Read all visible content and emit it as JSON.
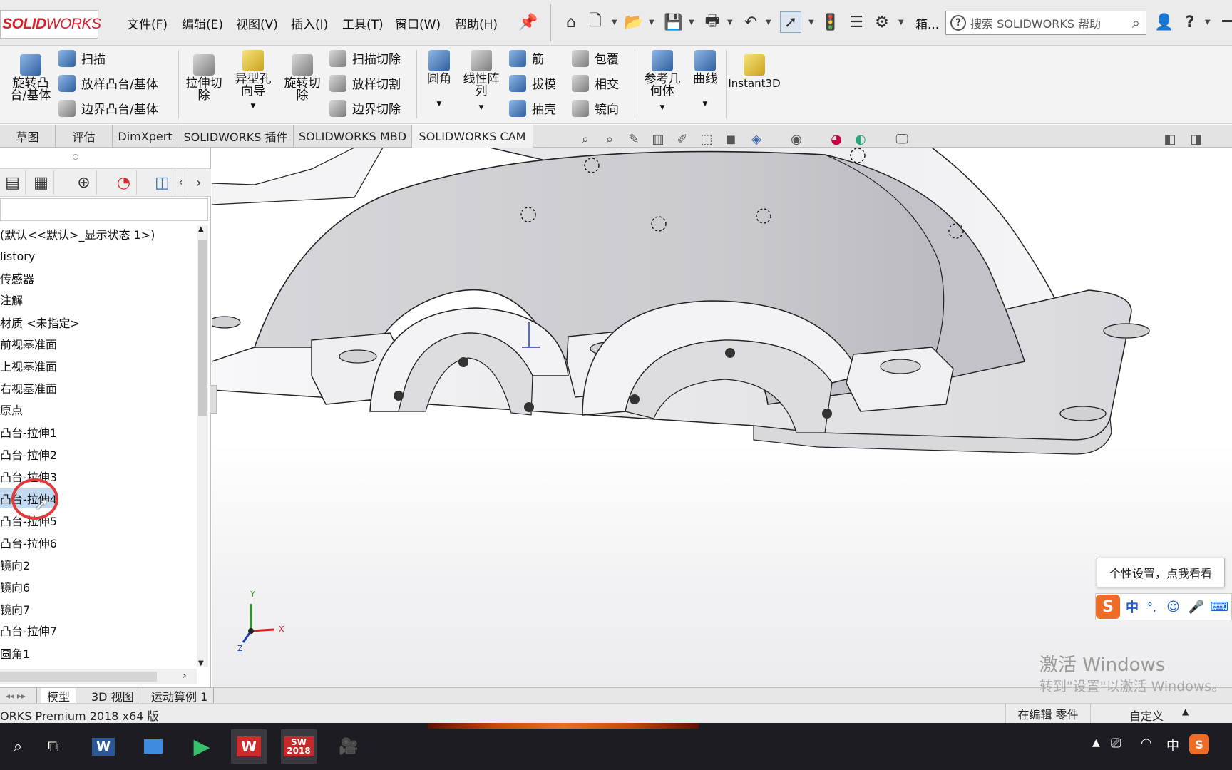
{
  "app": {
    "logo_brand_a": "SOLID",
    "logo_brand_b": "WORKS",
    "menu": [
      "文件(F)",
      "编辑(E)",
      "视图(V)",
      "插入(I)",
      "工具(T)",
      "窗口(W)",
      "帮助(H)"
    ],
    "truncated_menu": "箱...",
    "help_search_placeholder": "搜索 SOLIDWORKS 帮助"
  },
  "commands": {
    "revolve_boss": "旋转凸\n台/基体",
    "sweep": "扫描",
    "loft_boss": "放样凸台/基体",
    "boundary_boss": "边界凸台/基体",
    "extrude_cut": "拉伸切\n除",
    "hole_wizard": "异型孔\n向导",
    "revolve_cut": "旋转切\n除",
    "swept_cut": "扫描切除",
    "lofted_cut": "放样切割",
    "boundary_cut": "边界切除",
    "fillet": "圆角",
    "linear_pattern": "线性阵\n列",
    "rib": "筋",
    "draft": "拔模",
    "shell": "抽壳",
    "wrap": "包覆",
    "intersect": "相交",
    "mirror": "镜向",
    "reference_geometry": "参考几\n何体",
    "curves": "曲线",
    "instant3d": "Instant3D"
  },
  "tabs": [
    "草图",
    "评估",
    "DimXpert",
    "SOLIDWORKS 插件",
    "SOLIDWORKS MBD",
    "SOLIDWORKS CAM"
  ],
  "tree": {
    "root": "(默认<<默认>_显示状态 1>)",
    "items": [
      "listory",
      "传感器",
      "注解",
      "材质 <未指定>",
      "前视基准面",
      "上视基准面",
      "右视基准面",
      "原点",
      "凸台-拉伸1",
      "凸台-拉伸2",
      "凸台-拉伸3",
      "凸台-拉伸4",
      "凸台-拉伸5",
      "凸台-拉伸6",
      "镜向2",
      "镜向6",
      "镜向7",
      "凸台-拉伸7",
      "圆角1"
    ],
    "selected_index": 11
  },
  "bottom_tabs": [
    "模型",
    "3D 视图",
    "运动算例 1"
  ],
  "status": {
    "product": "ORKS Premium 2018 x64 版",
    "editing": "在编辑 零件",
    "custom": "自定义"
  },
  "overlays": {
    "ime_tip": "个性设置，点我看看",
    "ime_lang": "中",
    "activate_title": "激活 Windows",
    "activate_sub": "转到\"设置\"以激活 Windows。"
  },
  "taskbar": {
    "sw_badge": "2018",
    "tray_lang": "中"
  },
  "triad": {
    "x": "X",
    "y": "Y",
    "z": "Z"
  },
  "colors": {
    "brand_red": "#d8202c",
    "selection_blue": "#c2d9f2",
    "highlight_circle": "#e23a3a",
    "taskbar": "#1d1c22"
  }
}
